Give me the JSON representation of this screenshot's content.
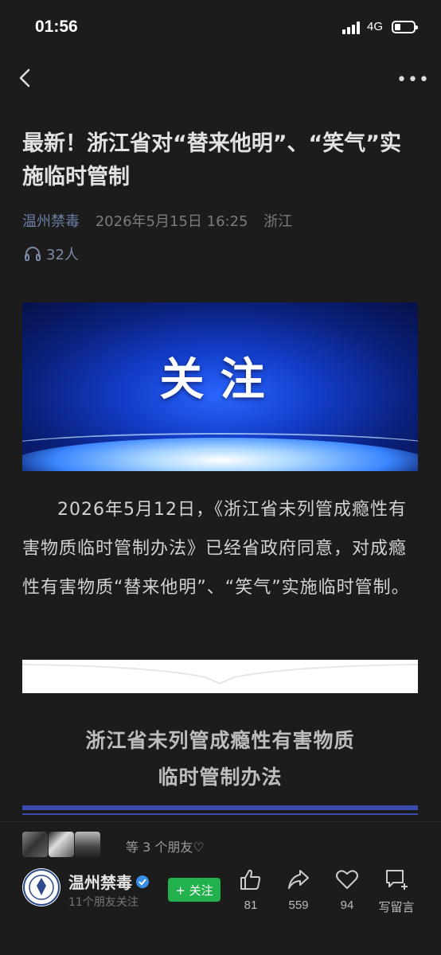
{
  "status_bar": {
    "time": "01:56",
    "network": "4G"
  },
  "nav": {
    "back_icon": "chevron-left-icon",
    "more_label": "•••"
  },
  "article": {
    "title": "最新！浙江省对“替来他明”、“笑气”实施临时管制",
    "author": "温州禁毒",
    "date": "2026年5月15日 16:25",
    "location": "浙江",
    "listeners": "32人",
    "banner_text": "关注",
    "paragraph": "2026年5月12日，《浙江省未列管成瘾性有害物质临时管制办法》已经省政府同意，对成瘾性有害物质“替来他明”、“笑气”实施临时管制。",
    "subtitle_line1": "浙江省未列管成瘾性有害物质",
    "subtitle_line2": "临时管制办法"
  },
  "bottom_bar": {
    "friends_text": "等 3 个朋友♡",
    "account_name": "温州禁毒",
    "account_sub": "11个朋友关注",
    "follow_label": "+ 关注",
    "like_count": "81",
    "share_count": "559",
    "fav_count": "94",
    "comment_label": "写留言"
  }
}
